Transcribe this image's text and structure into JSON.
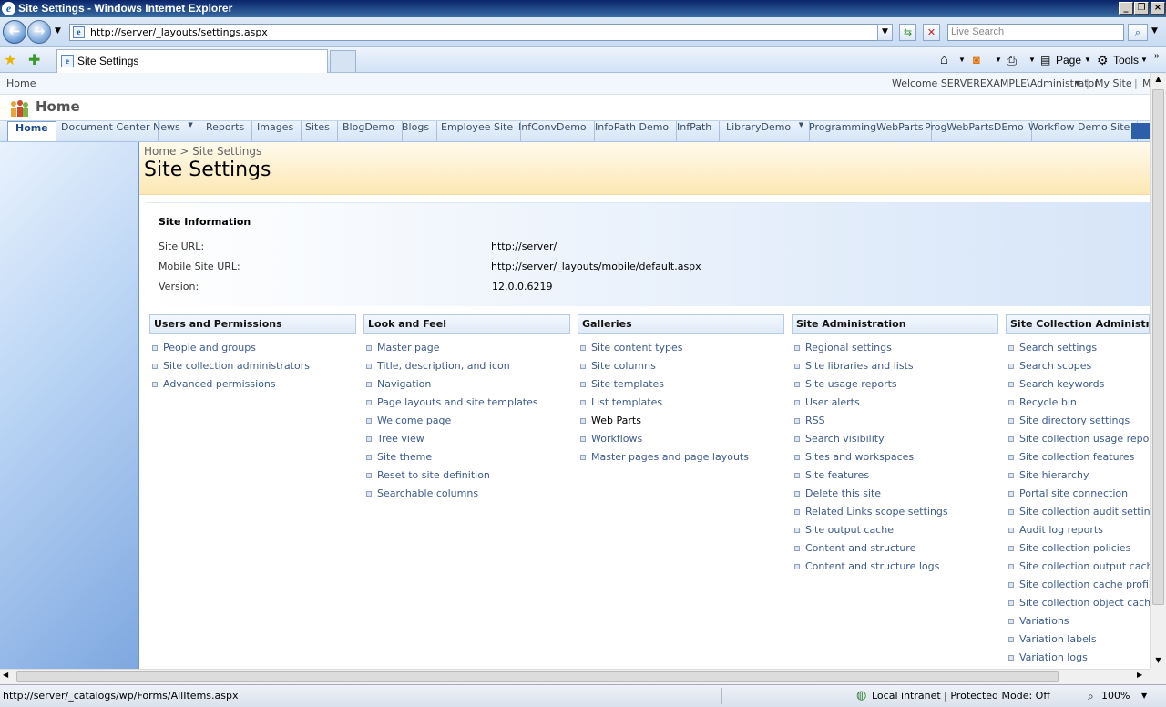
{
  "window": {
    "title": "Site Settings - Windows Internet Explorer"
  },
  "browser": {
    "url": "http://server/_layouts/settings.aspx",
    "search_placeholder": "Live Search",
    "tab_title": "Site Settings",
    "commands": {
      "page": "Page",
      "tools": "Tools"
    }
  },
  "sp": {
    "topbar_home": "Home",
    "welcome": "Welcome SERVEREXAMPLE\\Administrator",
    "mysite": "My Site",
    "site_name": "Home",
    "nav": [
      "Home",
      "Document Center",
      "News",
      "Reports",
      "Images",
      "Sites",
      "BlogDemo",
      "Blogs",
      "Employee Site",
      "InfConvDemo",
      "InfoPath Demo",
      "InfPath",
      "LibraryDemo",
      "ProgrammingWebParts",
      "ProgWebPartsDEmo",
      "Workflow Demo Site"
    ],
    "breadcrumb": "Home > Site Settings",
    "page_title": "Site Settings",
    "site_info": {
      "heading": "Site Information",
      "site_url_label": "Site URL:",
      "site_url": "http://server/",
      "mobile_label": "Mobile Site URL:",
      "mobile_url": "http://server/_layouts/mobile/default.aspx",
      "version_label": "Version:",
      "version": "12.0.0.6219"
    },
    "columns": [
      {
        "heading": "Users and Permissions",
        "links": [
          "People and groups",
          "Site collection administrators",
          "Advanced permissions"
        ]
      },
      {
        "heading": "Look and Feel",
        "links": [
          "Master page",
          "Title, description, and icon",
          "Navigation",
          "Page layouts and site templates",
          "Welcome page",
          "Tree view",
          "Site theme",
          "Reset to site definition",
          "Searchable columns"
        ]
      },
      {
        "heading": "Galleries",
        "links": [
          "Site content types",
          "Site columns",
          "Site templates",
          "List templates",
          "Web Parts",
          "Workflows",
          "Master pages and page layouts"
        ]
      },
      {
        "heading": "Site Administration",
        "links": [
          "Regional settings",
          "Site libraries and lists",
          "Site usage reports",
          "User alerts",
          "RSS",
          "Search visibility",
          "Sites and workspaces",
          "Site features",
          "Delete this site",
          "Related Links scope settings",
          "Site output cache",
          "Content and structure",
          "Content and structure logs"
        ]
      },
      {
        "heading": "Site Collection Administration",
        "links": [
          "Search settings",
          "Search scopes",
          "Search keywords",
          "Recycle bin",
          "Site directory settings",
          "Site collection usage reports",
          "Site collection features",
          "Site hierarchy",
          "Portal site connection",
          "Site collection audit settings",
          "Audit log reports",
          "Site collection policies",
          "Site collection output cache",
          "Site collection cache profiles",
          "Site collection object cache",
          "Variations",
          "Variation labels",
          "Variation logs"
        ]
      }
    ]
  },
  "status": {
    "url": "http://server/_catalogs/wp/Forms/AllItems.aspx",
    "zone": "Local intranet | Protected Mode: Off",
    "zoom": "100%"
  }
}
